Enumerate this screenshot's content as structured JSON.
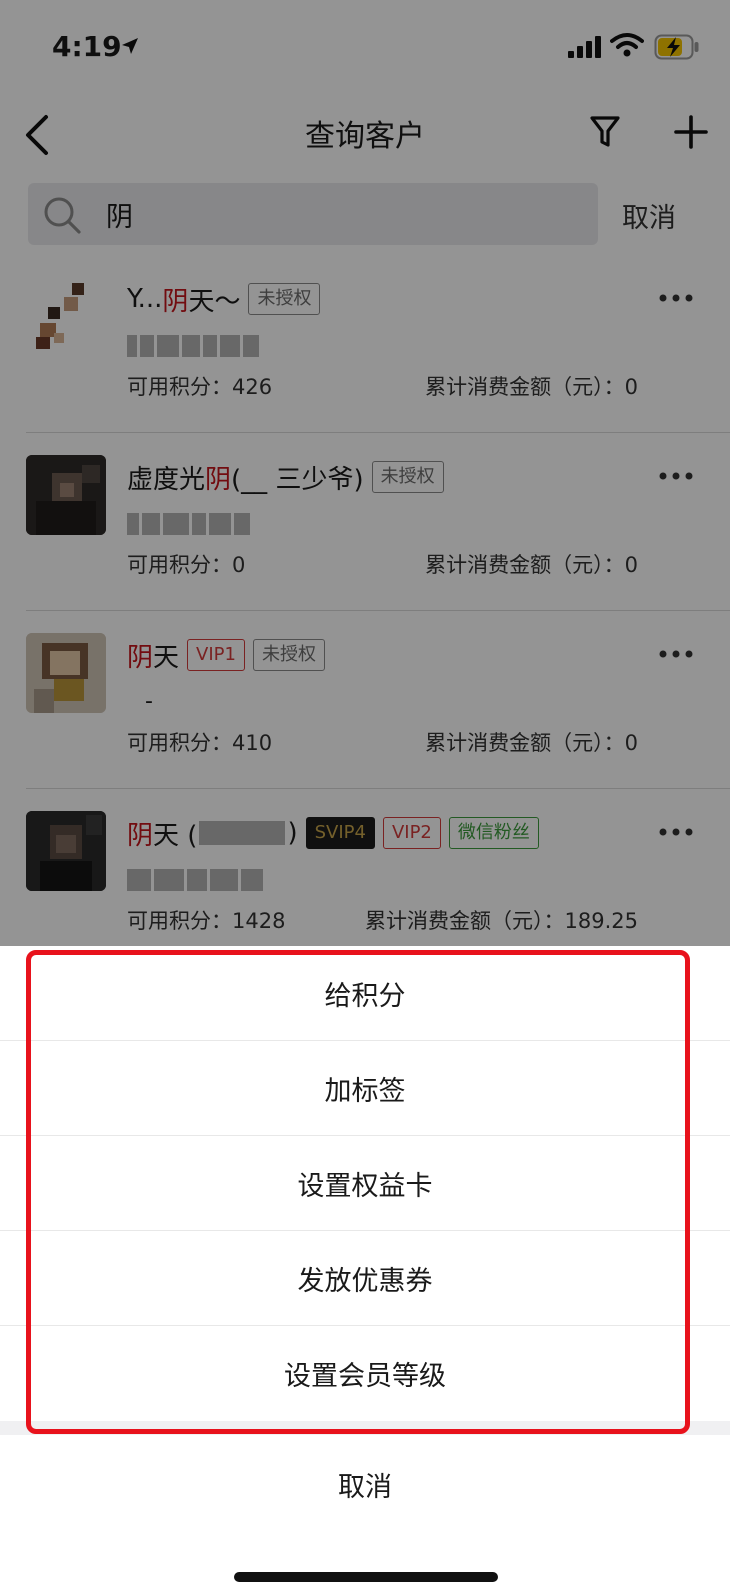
{
  "status_bar": {
    "time": "4:19"
  },
  "nav": {
    "title": "查询客户"
  },
  "search": {
    "value": "阴",
    "cancel_label": "取消"
  },
  "customers": [
    {
      "name_prefix": "Y...",
      "name_highlight": "阴",
      "name_suffix": "天～",
      "tags": [
        "未授权"
      ],
      "points_label": "可用积分：426",
      "consume_label": "累计消费金额（元）：0"
    },
    {
      "name_prefix": "虚度光",
      "name_highlight": "阴",
      "name_suffix": "(__ 三少爷)",
      "tags": [
        "未授权"
      ],
      "points_label": "可用积分：0",
      "consume_label": "累计消费金额（元）：0"
    },
    {
      "name_prefix": "",
      "name_highlight": "阴",
      "name_suffix": "天",
      "tags": [
        "VIP1",
        "未授权"
      ],
      "phone": "-",
      "points_label": "可用积分：410",
      "consume_label": "累计消费金额（元）：0"
    },
    {
      "name_prefix": "",
      "name_highlight": "阴",
      "name_suffix": "天 (",
      "name_after": ")",
      "tags": [
        "SVIP4",
        "VIP2",
        "微信粉丝"
      ],
      "points_label": "可用积分：1428",
      "consume_label": "累计消费金额（元）：189.25"
    }
  ],
  "action_sheet": {
    "items": [
      "给积分",
      "加标签",
      "设置权益卡",
      "发放优惠券",
      "设置会员等级"
    ],
    "cancel_label": "取消"
  },
  "colors": {
    "highlight_text": "#c4161c",
    "annotation_box": "#e8121c"
  }
}
